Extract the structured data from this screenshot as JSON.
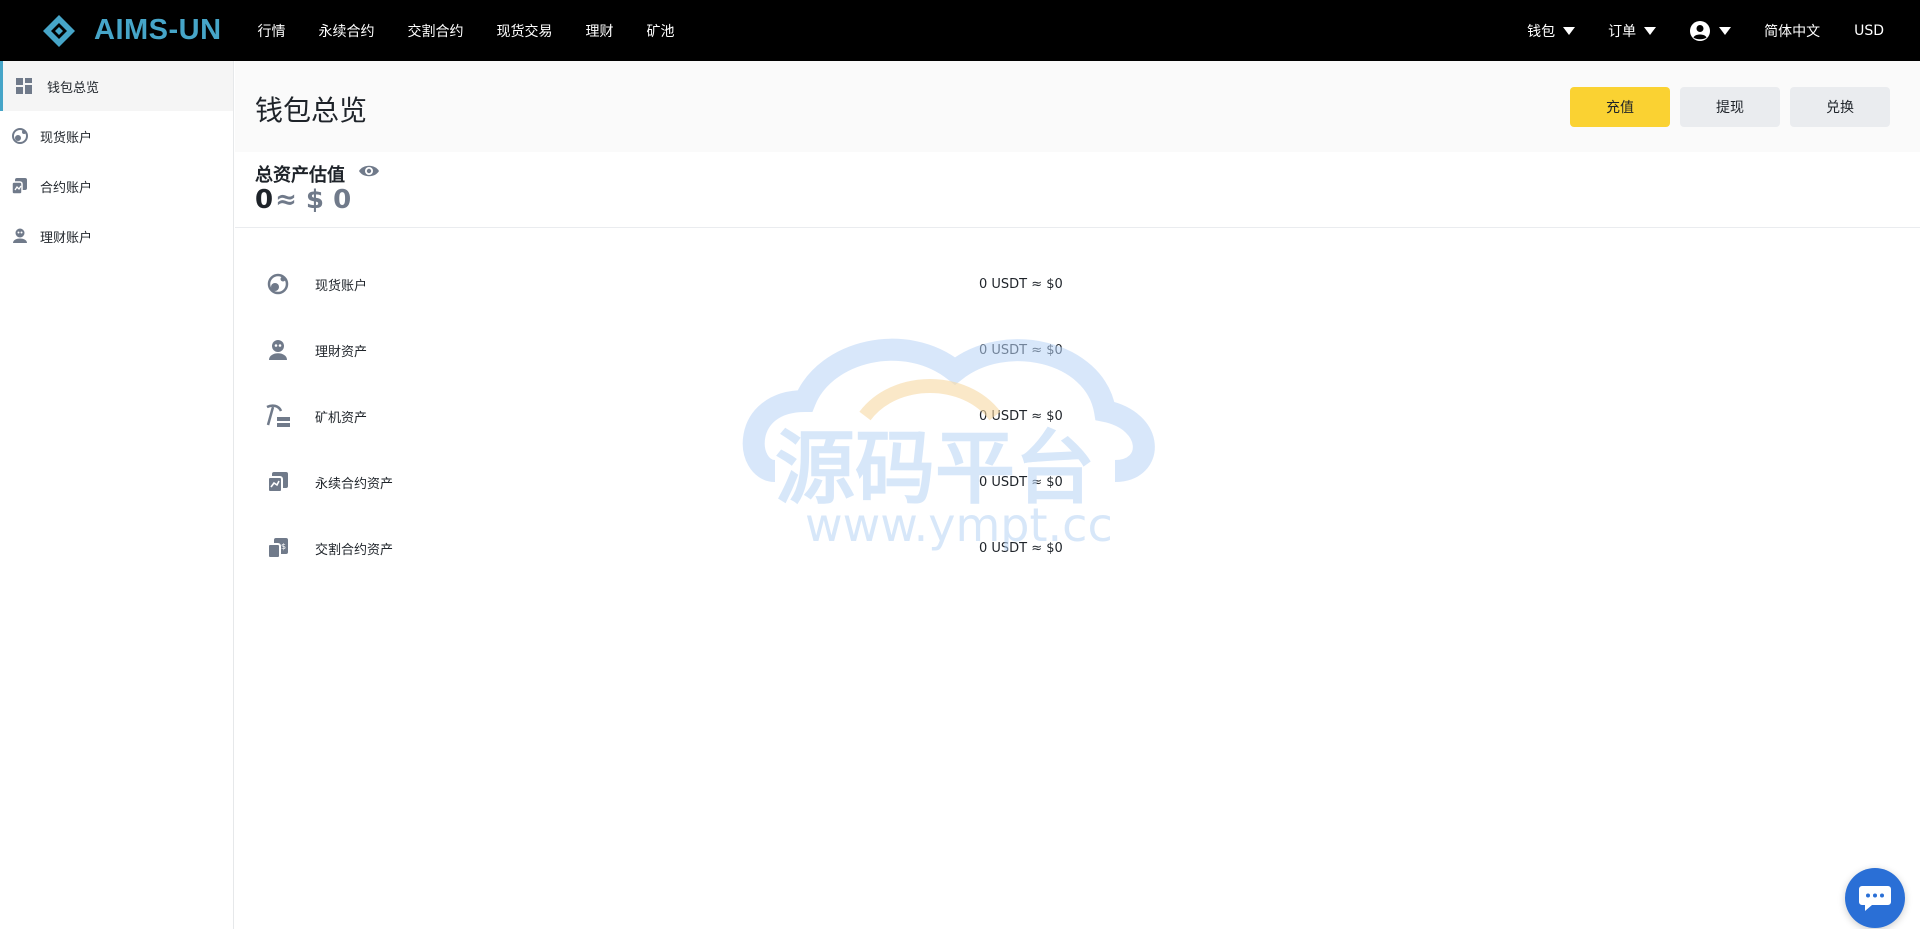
{
  "brand": {
    "name": "AIMS-UN",
    "color": "#46a5c8"
  },
  "nav": {
    "links": [
      "行情",
      "永续合约",
      "交割合约",
      "现货交易",
      "理财",
      "矿池"
    ],
    "wallet_label": "钱包",
    "orders_label": "订单",
    "language": "简体中文",
    "currency": "USD"
  },
  "sidebar": {
    "items": [
      {
        "label": "钱包总览",
        "icon": "grid-icon",
        "active": true
      },
      {
        "label": "现货账户",
        "icon": "spot-icon",
        "active": false
      },
      {
        "label": "合约账户",
        "icon": "contract-icon",
        "active": false
      },
      {
        "label": "理财账户",
        "icon": "finance-icon",
        "active": false
      }
    ]
  },
  "main": {
    "title": "钱包总览",
    "buttons": {
      "deposit": "充值",
      "withdraw": "提现",
      "convert": "兑换"
    },
    "total": {
      "label": "总资产估值",
      "btc": "0",
      "approx": "≈ $ 0"
    },
    "assets": [
      {
        "name": "现货账户",
        "value": "0 USDT ≈ $0",
        "icon": "spot-icon"
      },
      {
        "name": "理財资产",
        "value": "0 USDT ≈ $0",
        "icon": "finance-icon"
      },
      {
        "name": "矿机资产",
        "value": "0 USDT ≈ $0",
        "icon": "mining-icon"
      },
      {
        "name": "永续合约资产",
        "value": "0 USDT ≈ $0",
        "icon": "perpetual-icon"
      },
      {
        "name": "交割合约资产",
        "value": "0 USDT ≈ $0",
        "icon": "delivery-icon"
      }
    ]
  },
  "watermark": {
    "title": "源码平台",
    "url": "www.ympt.cc"
  },
  "colors": {
    "accent_yellow": "#fad232",
    "topbar": "#000000",
    "button_gray": "#eaecef"
  }
}
